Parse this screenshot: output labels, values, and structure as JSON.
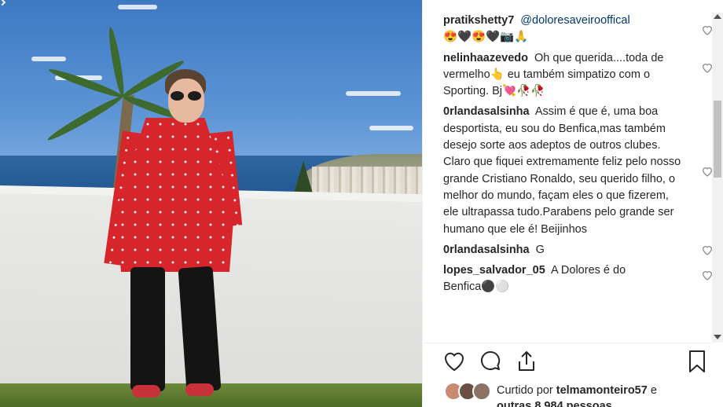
{
  "post": {
    "comments": [
      {
        "user": "pratikshetty7",
        "mention": "@doloresaveirooffical",
        "text": "😍🖤😍🖤📷🙏"
      },
      {
        "user": "nelinhaazevedo",
        "text": "Oh que querida....toda de vermelho👆 eu também simpatizo com o Sporting. Bj💘🥀🥀"
      },
      {
        "user": "0rlandasalsinha",
        "text": "Assim é que é, uma boa desportista, eu sou do Benfica,mas também desejo sorte aos adeptos de outros clubes. Claro que fiquei extremamente feliz pelo nosso grande Cristiano Ronaldo, seu querido filho, o melhor do mundo, façam eles o que fizerem, ele ultrapassa tudo.Parabens pelo grande ser humano que ele é! Beijinhos"
      },
      {
        "user": "0rlandasalsinha",
        "text": "G"
      },
      {
        "user": "lopes_salvador_05",
        "text": "A Dolores é do Benfica⚫⚪"
      }
    ],
    "likes": {
      "prefix": "Curtido por",
      "user": "telmamonteiro57",
      "suffix": "e",
      "others": "outras 8.984 pessoas"
    },
    "icons": {
      "comment_like": "heart-outline-icon",
      "like": "heart-icon",
      "comment": "comment-bubble-icon",
      "share": "share-arrow-icon",
      "save": "bookmark-icon"
    },
    "colors": {
      "text": "#262626",
      "mention": "#00376b",
      "shirt": "#d7262b"
    }
  }
}
